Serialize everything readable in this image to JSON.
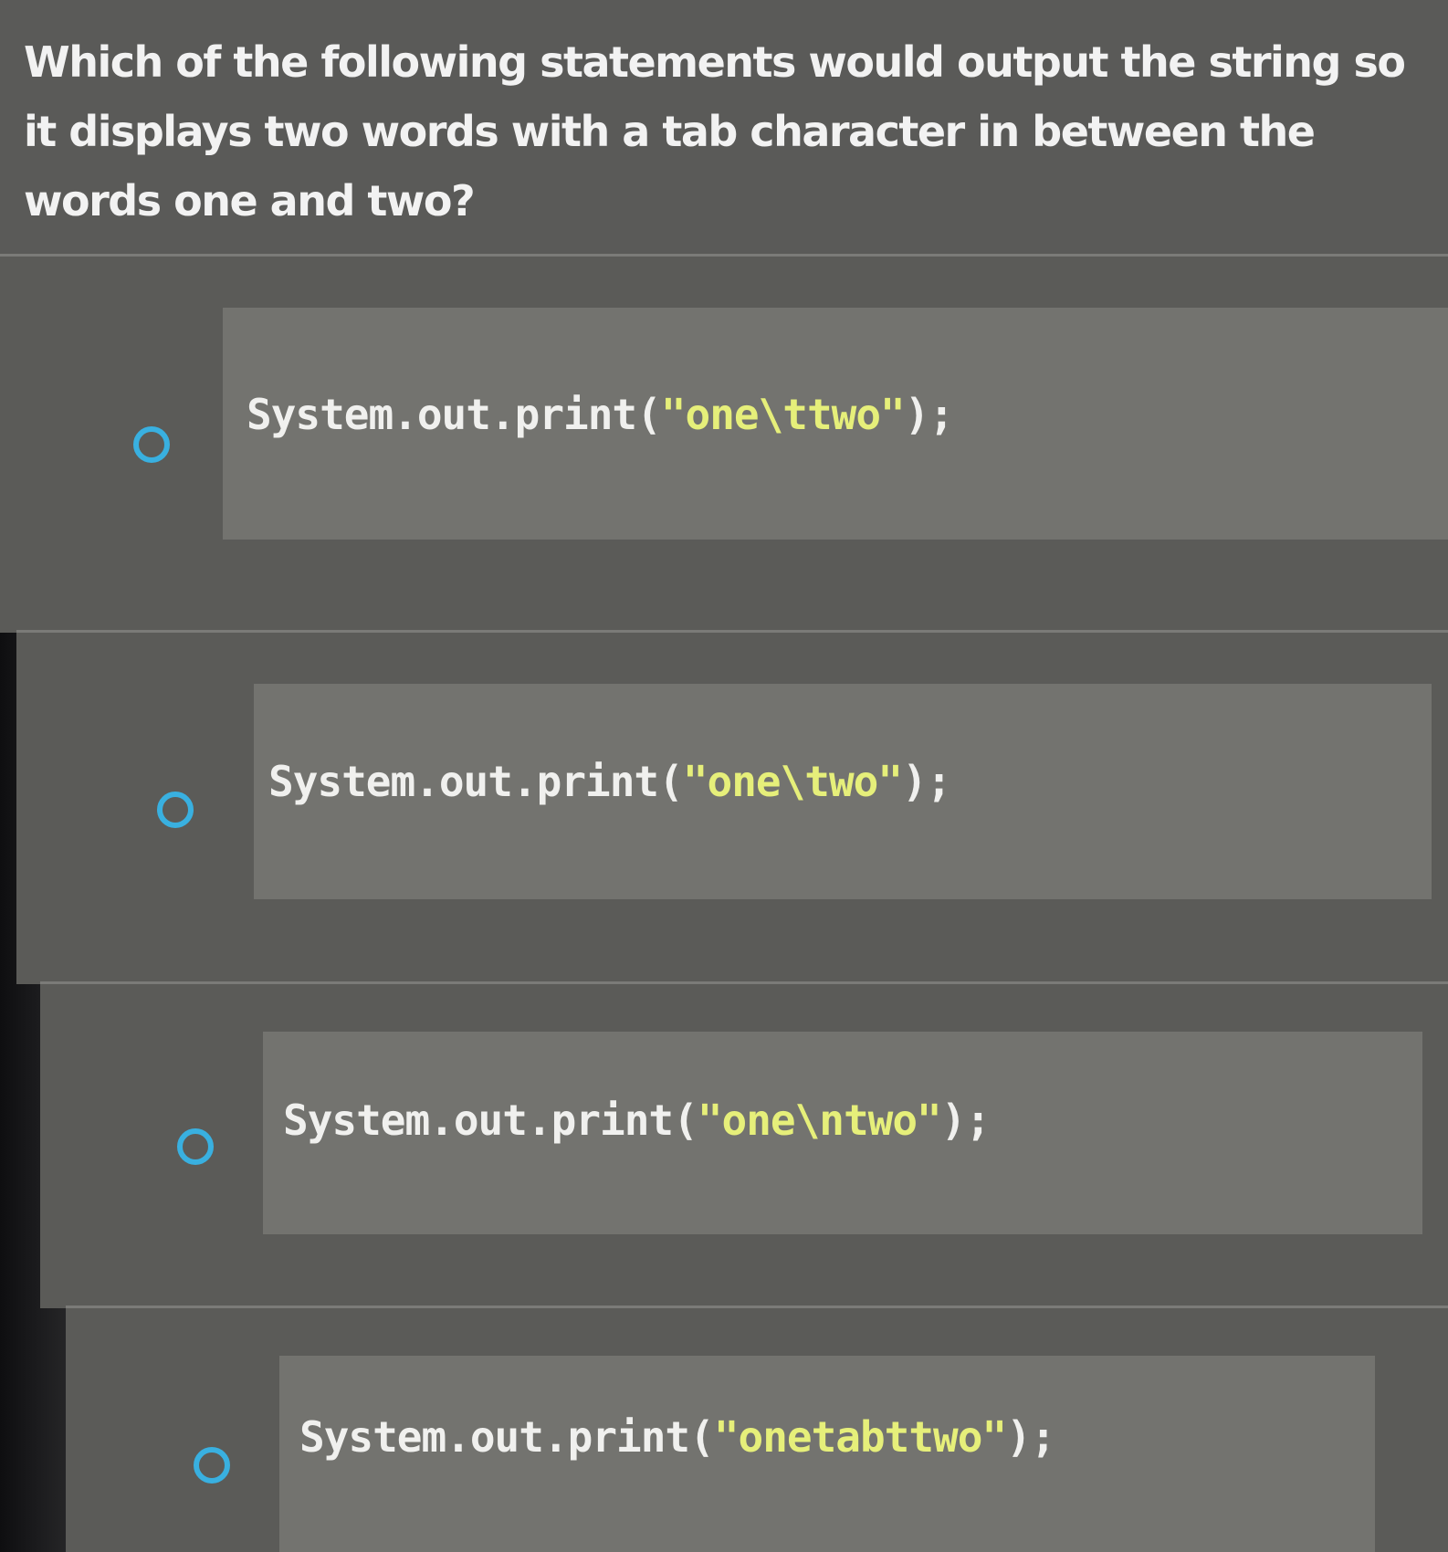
{
  "question": {
    "text": "Which of the following statements would output the string so it displays two words with a tab character in between the words one and two?"
  },
  "options": [
    {
      "prefix": "System.out.print(",
      "string": "\"one\\ttwo\"",
      "suffix": ");"
    },
    {
      "prefix": "System.out.print(",
      "string": "\"one\\two\"",
      "suffix": ");"
    },
    {
      "prefix": "System.out.print(",
      "string": "\"one\\ntwo\"",
      "suffix": ");"
    },
    {
      "prefix": "System.out.print(",
      "string": "\"onetabttwo\"",
      "suffix": ");"
    }
  ],
  "colors": {
    "radio_border": "#39b0e0",
    "string_literal": "#e6ef7a",
    "code_text": "#f0f0ee",
    "panel": "#5b5b58",
    "code_box": "#73736f"
  }
}
